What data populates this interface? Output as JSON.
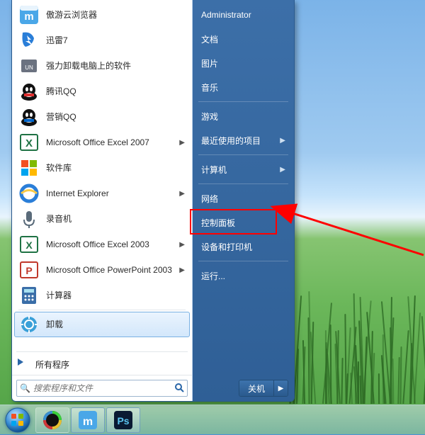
{
  "left_panel": {
    "programs": [
      {
        "label": "傲游云浏览器",
        "icon": "maxthon",
        "has_arrow": false
      },
      {
        "label": "迅雷7",
        "icon": "thunder",
        "has_arrow": false
      },
      {
        "label": "强力卸载电脑上的软件",
        "icon": "uninstall",
        "has_arrow": false
      },
      {
        "label": "腾讯QQ",
        "icon": "qq",
        "has_arrow": false
      },
      {
        "label": "营销QQ",
        "icon": "qq-blue",
        "has_arrow": false
      },
      {
        "label": "Microsoft Office Excel 2007",
        "icon": "excel2007",
        "has_arrow": true
      },
      {
        "label": "软件库",
        "icon": "softlib",
        "has_arrow": false
      },
      {
        "label": "Internet Explorer",
        "icon": "ie",
        "has_arrow": true
      },
      {
        "label": "录音机",
        "icon": "recorder",
        "has_arrow": false
      },
      {
        "label": "Microsoft Office Excel 2003",
        "icon": "excel2003",
        "has_arrow": true
      },
      {
        "label": "Microsoft Office PowerPoint 2003",
        "icon": "ppt2003",
        "has_arrow": true
      },
      {
        "label": "计算器",
        "icon": "calc",
        "has_arrow": false
      },
      {
        "label": "卸载",
        "icon": "uninstall-gear",
        "has_arrow": false,
        "selected": true
      }
    ],
    "all_programs": {
      "label": "所有程序"
    },
    "search": {
      "placeholder": "搜索程序和文件"
    }
  },
  "right_panel": {
    "items": [
      {
        "label": "Administrator",
        "arrow": false,
        "sep_after": false
      },
      {
        "label": "文档",
        "arrow": false,
        "sep_after": false
      },
      {
        "label": "图片",
        "arrow": false,
        "sep_after": false
      },
      {
        "label": "音乐",
        "arrow": false,
        "sep_after": true
      },
      {
        "label": "游戏",
        "arrow": false,
        "sep_after": false
      },
      {
        "label": "最近使用的项目",
        "arrow": true,
        "sep_after": true
      },
      {
        "label": "计算机",
        "arrow": true,
        "sep_after": true
      },
      {
        "label": "网络",
        "arrow": false,
        "sep_after": false
      },
      {
        "label": "控制面板",
        "arrow": false,
        "sep_after": false,
        "highlighted": true
      },
      {
        "label": "设备和打印机",
        "arrow": false,
        "sep_after": true
      },
      {
        "label": "运行...",
        "arrow": false,
        "sep_after": false
      }
    ],
    "shutdown": {
      "label": "关机"
    }
  },
  "taskbar": {
    "buttons": [
      {
        "name": "swirl-app",
        "icon": "swirl",
        "active": false
      },
      {
        "name": "maxthon-app",
        "icon": "maxthon-sq",
        "active": true
      },
      {
        "name": "photoshop-app",
        "icon": "ps",
        "active": true
      }
    ]
  },
  "annotation": {
    "highlight_target": "控制面板"
  }
}
